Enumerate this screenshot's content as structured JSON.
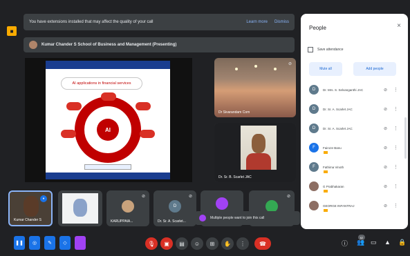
{
  "banner": {
    "message": "You have extensions installed that may affect the quality of your call",
    "learn_more": "Learn more",
    "dismiss": "Dismiss"
  },
  "presenting": {
    "text": "Kumar Chander S School of Business and Management (Presenting)"
  },
  "slide": {
    "title": "AI applications in financial services",
    "center": "AI",
    "header_mini": "",
    "footer": ""
  },
  "tiles": {
    "hall_label": "Dr Sivarandam Com",
    "speaker_label": "Dr. Sr. B. Scarlet JAC",
    "t1_label": "Kumar Chander S",
    "t3_label": "KARUPPAIA...",
    "t4_label": "Dr. Sr. A. Scarlet...",
    "t4_avatar": "D"
  },
  "panel": {
    "title": "People",
    "close": "×",
    "save_attendance": "Save attendance",
    "mute_all": "Mute all",
    "add_people": "Add people",
    "participants": [
      {
        "initial": "D",
        "name": "Dr. Mrs. S. Selvanganthi JAC",
        "color": "#5f7a8c",
        "tag": false
      },
      {
        "initial": "D",
        "name": "Dr. Sr. A. Scarlet JAC",
        "color": "#5f7a8c",
        "tag": false
      },
      {
        "initial": "D",
        "name": "Dr. Sr. A. Scarlet JAC",
        "color": "#5f7a8c",
        "tag": false
      },
      {
        "initial": "F",
        "name": "Fairoze Banu",
        "color": "#1a73e8",
        "tag": true
      },
      {
        "initial": "F",
        "name": "Fathima Vinoth",
        "color": "#5f7a8c",
        "tag": true
      },
      {
        "initial": "G",
        "name": "G Prabhakaran",
        "color": "#8d6e63",
        "tag": true
      },
      {
        "initial": "G",
        "name": "GEORGE INFANTRAJ",
        "color": "#8d6e63",
        "tag": true
      }
    ]
  },
  "toast": {
    "text": "Multiple people want to join this call"
  },
  "controls": {
    "participant_count": "62",
    "bottom_name": "Kumar Ch..."
  }
}
